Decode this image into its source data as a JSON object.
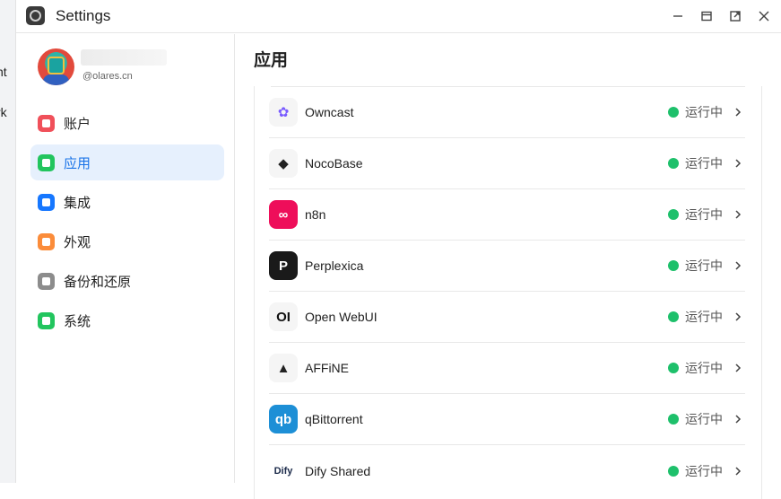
{
  "background_fragments": [
    "nt",
    "rk"
  ],
  "window": {
    "title": "Settings",
    "controls": [
      "minimize-icon",
      "restore-icon",
      "popout-icon",
      "close-icon"
    ]
  },
  "user": {
    "handle": "@olares.cn"
  },
  "sidebar": {
    "items": [
      {
        "label": "账户",
        "icon": "account-icon",
        "color": "#f0505a",
        "active": false
      },
      {
        "label": "应用",
        "icon": "apps-icon",
        "color": "#22c55e",
        "active": true
      },
      {
        "label": "集成",
        "icon": "integration-icon",
        "color": "#1677ff",
        "active": false
      },
      {
        "label": "外观",
        "icon": "appearance-icon",
        "color": "#fb8c3a",
        "active": false
      },
      {
        "label": "备份和还原",
        "icon": "backup-icon",
        "color": "#8c8c8c",
        "active": false
      },
      {
        "label": "系统",
        "icon": "system-icon",
        "color": "#22c55e",
        "active": false
      }
    ]
  },
  "main": {
    "title": "应用",
    "apps": [
      {
        "name": "Owncast",
        "status": "运行中",
        "logo_bg": "#f5f5f5",
        "logo_text": "✿",
        "logo_color": "#7a5cff"
      },
      {
        "name": "NocoBase",
        "status": "运行中",
        "logo_bg": "#f5f5f5",
        "logo_text": "◆",
        "logo_color": "#222222"
      },
      {
        "name": "n8n",
        "status": "运行中",
        "logo_bg": "#ee0e5a",
        "logo_text": "∞",
        "logo_color": "#ffffff"
      },
      {
        "name": "Perplexica",
        "status": "运行中",
        "logo_bg": "#1a1a1a",
        "logo_text": "P",
        "logo_color": "#ffffff"
      },
      {
        "name": "Open WebUI",
        "status": "运行中",
        "logo_bg": "#f5f5f5",
        "logo_text": "OI",
        "logo_color": "#111111"
      },
      {
        "name": "AFFiNE",
        "status": "运行中",
        "logo_bg": "#f5f5f5",
        "logo_text": "▲",
        "logo_color": "#222222"
      },
      {
        "name": "qBittorrent",
        "status": "运行中",
        "logo_bg": "#1d8fd6",
        "logo_text": "qb",
        "logo_color": "#ffffff"
      },
      {
        "name": "Dify Shared",
        "status": "运行中",
        "logo_bg": "#ffffff",
        "logo_text": "Dify",
        "logo_color": "#1b2a4a"
      }
    ],
    "status_color": "#1ec06b"
  }
}
